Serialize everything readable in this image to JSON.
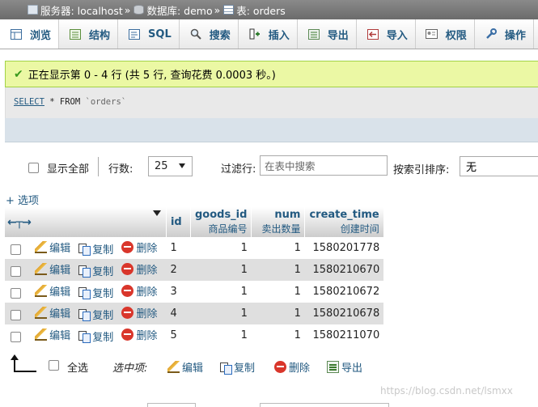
{
  "breadcrumb": {
    "server_label": "服务器: localhost",
    "db_label": "数据库: demo",
    "table_label": "表: orders",
    "separator": "»"
  },
  "tabs": [
    {
      "label": "浏览",
      "icon": "browse-icon",
      "active": true
    },
    {
      "label": "结构",
      "icon": "structure-icon"
    },
    {
      "label": "SQL",
      "icon": "sql-icon"
    },
    {
      "label": "搜索",
      "icon": "search-icon"
    },
    {
      "label": "插入",
      "icon": "insert-icon"
    },
    {
      "label": "导出",
      "icon": "export-icon"
    },
    {
      "label": "导入",
      "icon": "import-icon"
    },
    {
      "label": "权限",
      "icon": "privileges-icon"
    },
    {
      "label": "操作",
      "icon": "wrench-icon"
    }
  ],
  "message": {
    "text": "正在显示第 0 - 4 行 (共 5 行, 查询花费 0.0003 秒。)",
    "color": "#ebf8a4"
  },
  "sql": {
    "select": "SELECT",
    "rest": " * FROM ",
    "table": "`orders`"
  },
  "navigation": {
    "show_all": "显示全部",
    "rows_label": "行数:",
    "rows_value": "25",
    "filter_label": "过滤行:",
    "filter_placeholder": "在表中搜索",
    "sort_label": "按索引排序:",
    "sort_value": "无"
  },
  "options_link": "+ 选项",
  "table": {
    "columns": [
      {
        "name": "id",
        "comment": ""
      },
      {
        "name": "goods_id",
        "comment": "商品编号"
      },
      {
        "name": "num",
        "comment": "卖出数量"
      },
      {
        "name": "create_time",
        "comment": "创建时间"
      }
    ],
    "actions": {
      "edit": "编辑",
      "copy": "复制",
      "delete": "删除"
    },
    "rows": [
      {
        "id": "1",
        "goods_id": "1",
        "num": "1",
        "create_time": "1580201778"
      },
      {
        "id": "2",
        "goods_id": "1",
        "num": "1",
        "create_time": "1580210670"
      },
      {
        "id": "3",
        "goods_id": "1",
        "num": "1",
        "create_time": "1580210672"
      },
      {
        "id": "4",
        "goods_id": "1",
        "num": "1",
        "create_time": "1580210678"
      },
      {
        "id": "5",
        "goods_id": "1",
        "num": "1",
        "create_time": "1580211070"
      }
    ]
  },
  "bottom": {
    "select_all": "全选",
    "selected_label": "选中项:",
    "edit": "编辑",
    "copy": "复制",
    "delete": "删除",
    "export": "导出"
  },
  "watermark": "https://blog.csdn.net/lsmxx",
  "colors": {
    "link": "#235a81",
    "accent_green": "#a2d246"
  }
}
